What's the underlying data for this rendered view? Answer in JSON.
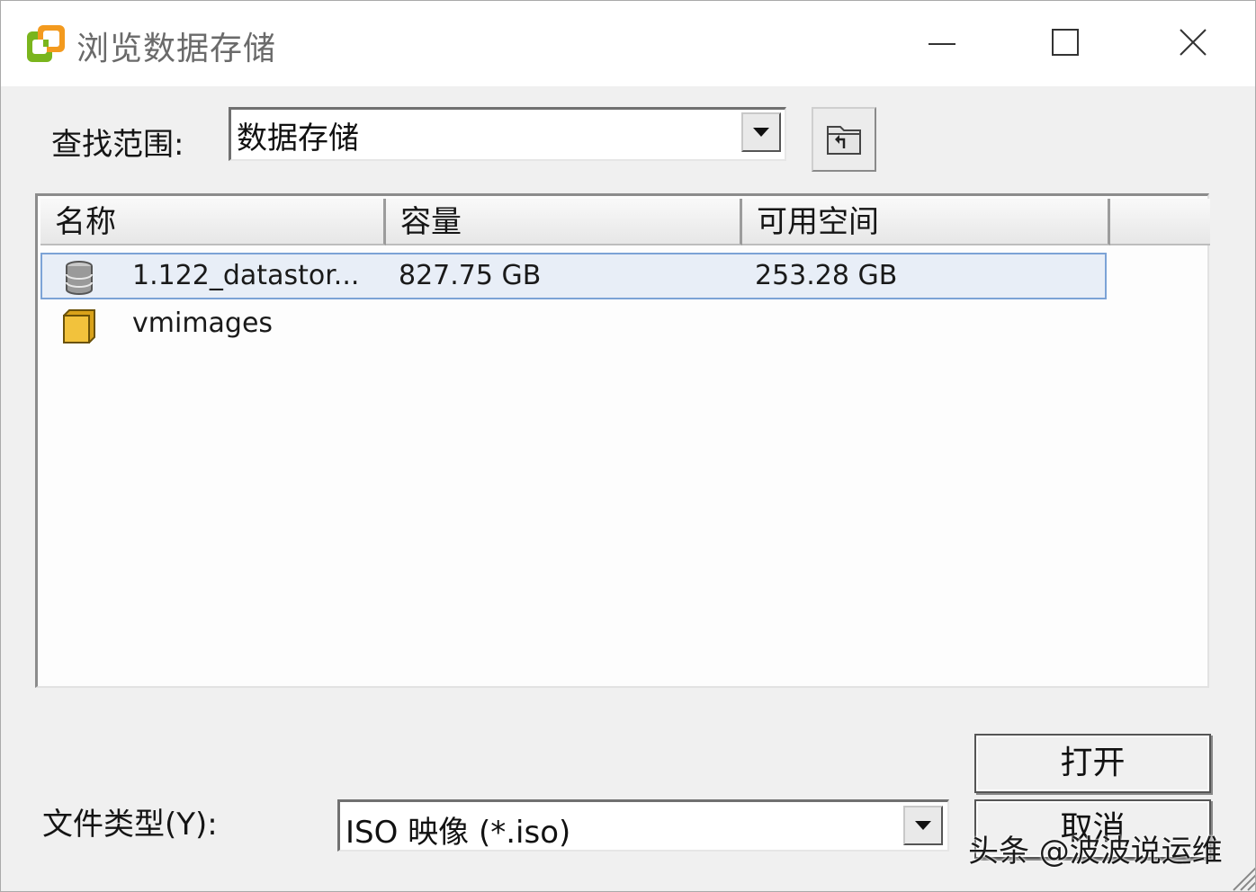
{
  "window": {
    "title": "浏览数据存储",
    "app_icon": "vsphere-client-icon",
    "controls": [
      "minimize-icon",
      "maximize-icon",
      "close-icon"
    ]
  },
  "lookin": {
    "label": "查找范围:",
    "value": "数据存储",
    "up_button_icon": "folder-up-icon"
  },
  "list": {
    "columns": [
      "名称",
      "容量",
      "可用空间"
    ],
    "rows": [
      {
        "name": "1.122_datastor...",
        "capacity": "827.75 GB",
        "free": "253.28 GB",
        "icon": "datastore-icon",
        "selected": true
      },
      {
        "name": "vmimages",
        "capacity": "",
        "free": "",
        "icon": "folder-icon",
        "selected": false
      }
    ]
  },
  "filetype": {
    "label": "文件类型(Y):",
    "value": "ISO 映像 (*.iso)"
  },
  "buttons": {
    "open": "打开",
    "cancel": "取消"
  },
  "watermark": "头条 @波波说运维",
  "colors": {
    "selection_fill": "#e8eef7",
    "selection_border": "#7ca3d6",
    "folder": "#f2c23c",
    "app_icon_green": "#7ab51d",
    "app_icon_orange": "#f39a1e"
  }
}
